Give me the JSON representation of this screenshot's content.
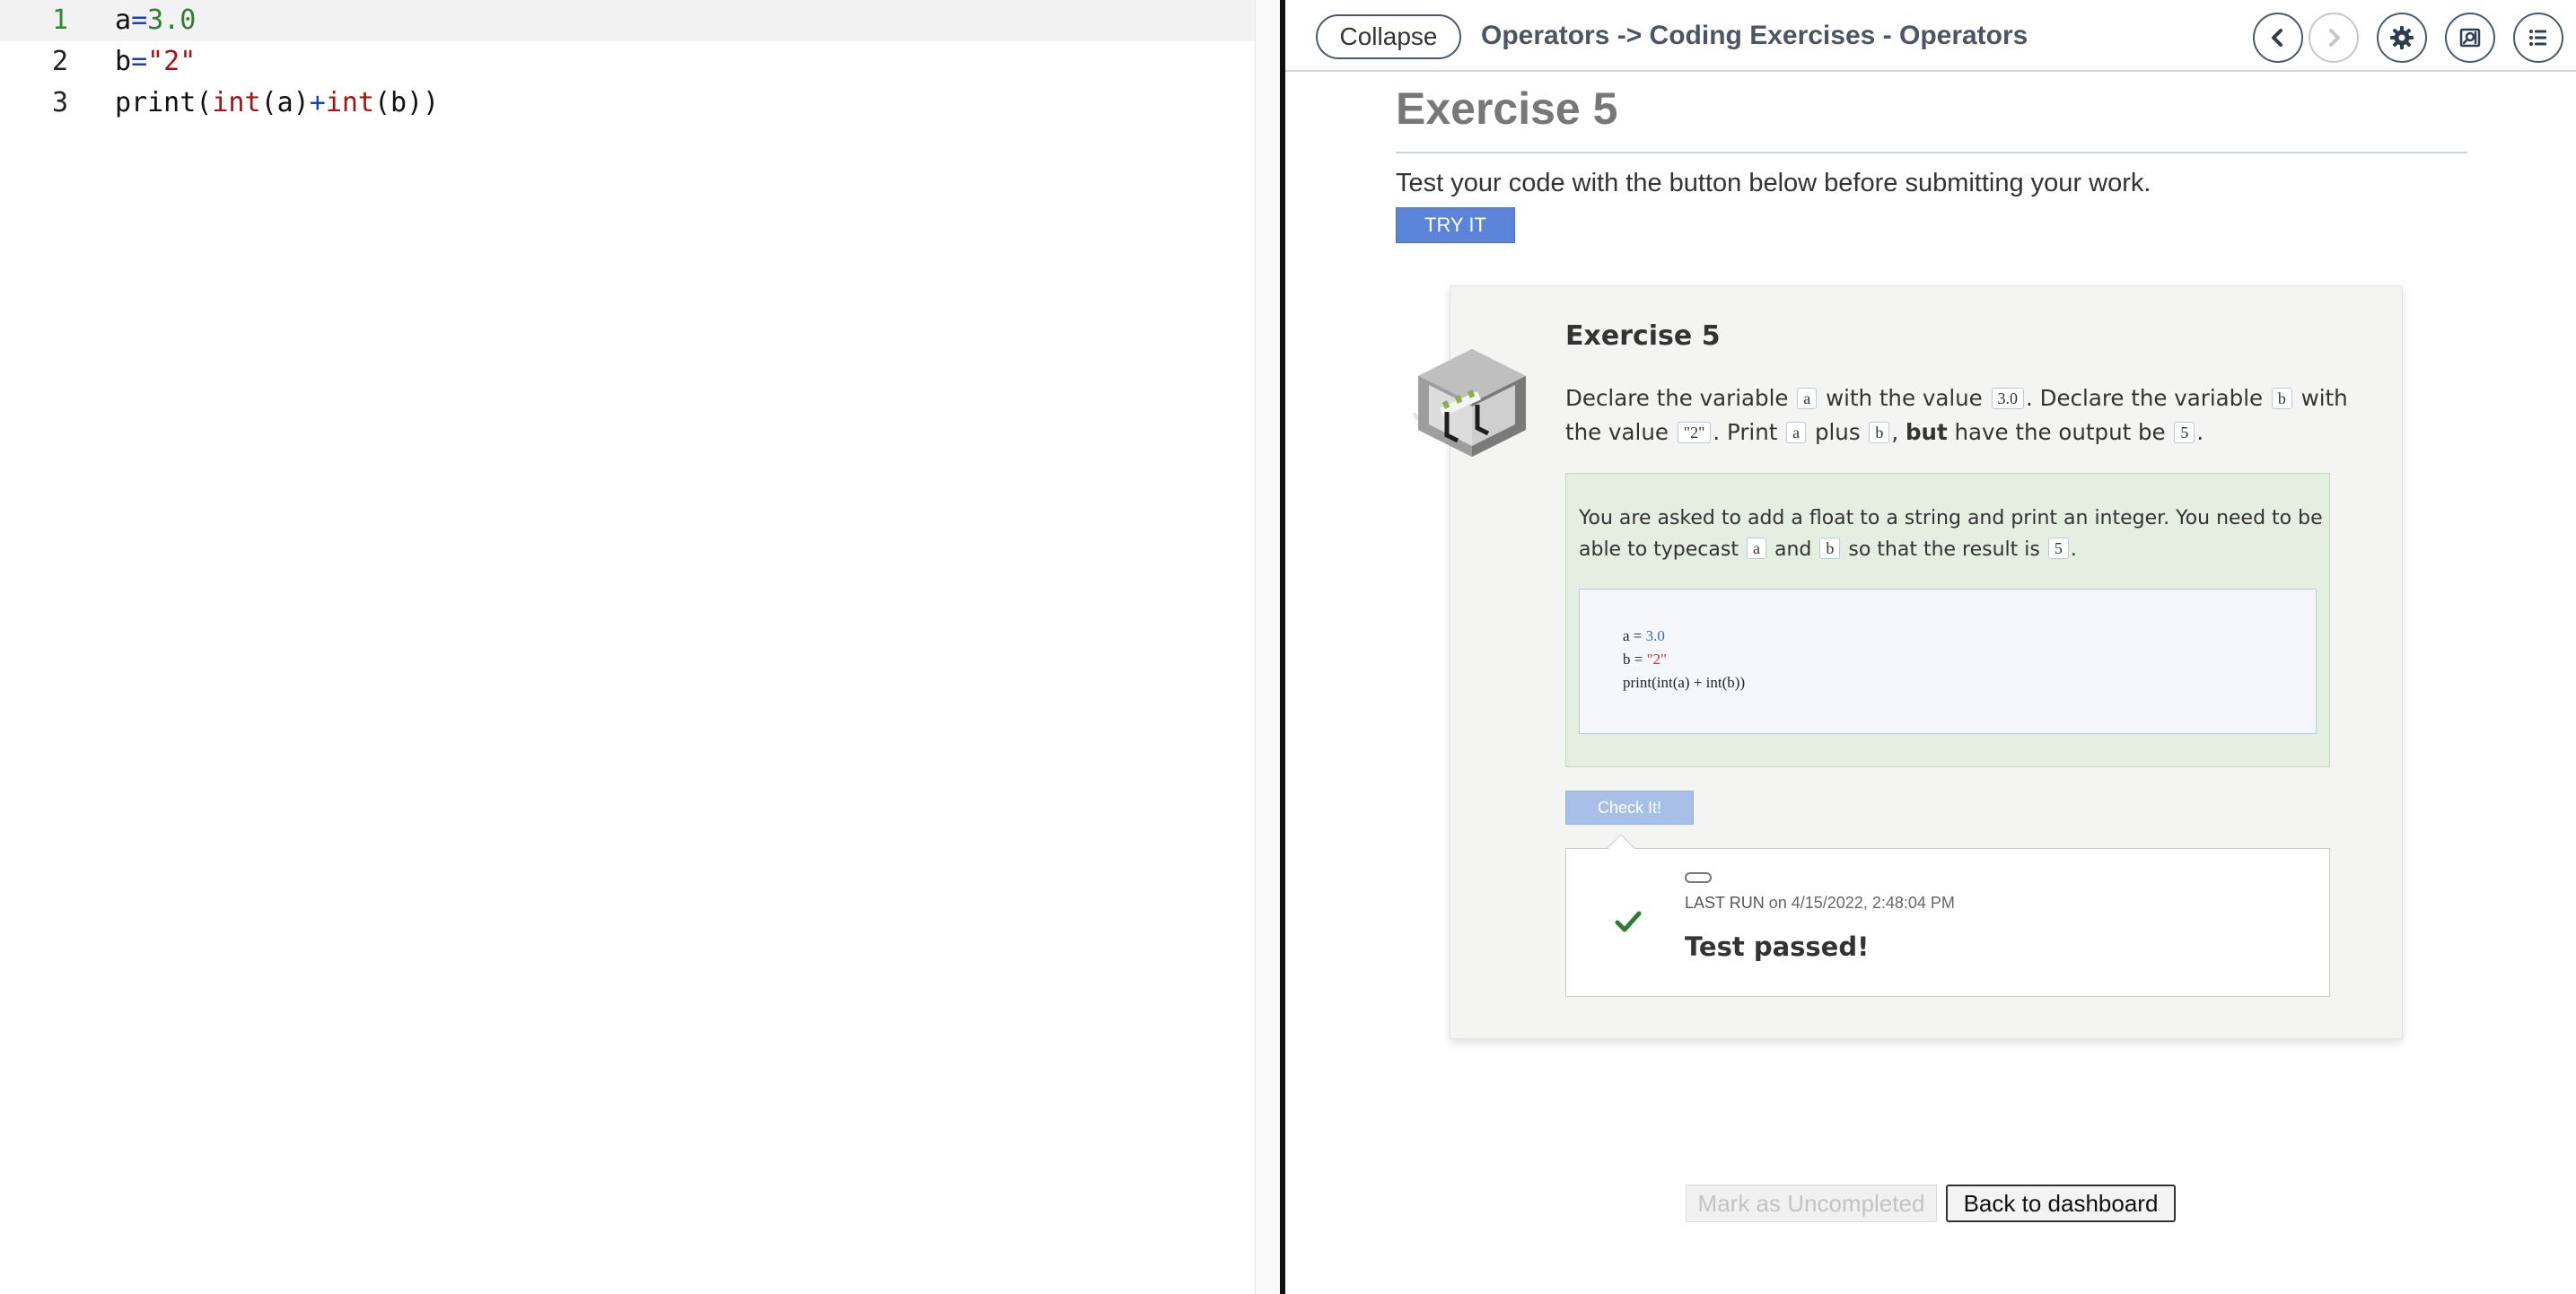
{
  "editor": {
    "lines": [
      {
        "number": "1",
        "tokens": [
          {
            "text": "a",
            "kind": "plain"
          },
          {
            "text": "=",
            "kind": "op"
          },
          {
            "text": "3.0",
            "kind": "num"
          }
        ]
      },
      {
        "number": "2",
        "tokens": [
          {
            "text": "b",
            "kind": "plain"
          },
          {
            "text": "=",
            "kind": "op"
          },
          {
            "text": "\"2\"",
            "kind": "str"
          }
        ]
      },
      {
        "number": "3",
        "tokens": [
          {
            "text": "print(",
            "kind": "plain"
          },
          {
            "text": "int",
            "kind": "fn"
          },
          {
            "text": "(a)",
            "kind": "plain"
          },
          {
            "text": "+",
            "kind": "op"
          },
          {
            "text": "int",
            "kind": "fn"
          },
          {
            "text": "(b))",
            "kind": "plain"
          }
        ]
      }
    ],
    "active_line": 1
  },
  "topbar": {
    "collapse_label": "Collapse",
    "title": "Operators -> Coding Exercises - Operators",
    "icons": [
      "chevron-left-icon",
      "chevron-right-icon",
      "gear-icon",
      "search-reader-icon",
      "list-icon"
    ]
  },
  "exercise": {
    "heading": "Exercise 5",
    "test_note": "Test your code with the button below before submitting your work.",
    "try_label": "TRY IT",
    "card_title": "Exercise 5",
    "desc": {
      "p1": "Declare the variable",
      "c1": "a",
      "p2": "with the value",
      "c2": "3.0",
      "p3": ". Declare the variable",
      "c3": "b",
      "p4": "with the value",
      "c4": "\"2\"",
      "p5": ". Print",
      "c5": "a",
      "p6": "plus",
      "c6": "b",
      "p7": ",",
      "bold": "but",
      "p8": "have the output be",
      "c7": "5",
      "p9": "."
    },
    "hint": {
      "p1": "You are asked to add a float to a string and print an integer. You need to be able to typecast",
      "c1": "a",
      "p2": "and",
      "c2": "b",
      "p3": "so that the result is",
      "c3": "5",
      "p4": "."
    },
    "sample_code": {
      "l1_a": "a = ",
      "l1_b": "3.0",
      "l2_a": "b = ",
      "l2_b": "\"2\"",
      "l3": "print(int(a) + int(b))"
    },
    "check_label": "Check It!",
    "result": {
      "last_run_label": "LAST RUN",
      "last_run_time": "on 4/15/2022, 2:48:04 PM",
      "status": "Test passed!"
    }
  },
  "footer": {
    "mark_label": "Mark as Uncompleted",
    "back_label": "Back to dashboard"
  },
  "colors": {
    "accent_button": "#5b84d9",
    "check_button_disabled": "#a8c0e8",
    "success_green": "#2e7d32",
    "hint_background": "#e4eee1"
  }
}
